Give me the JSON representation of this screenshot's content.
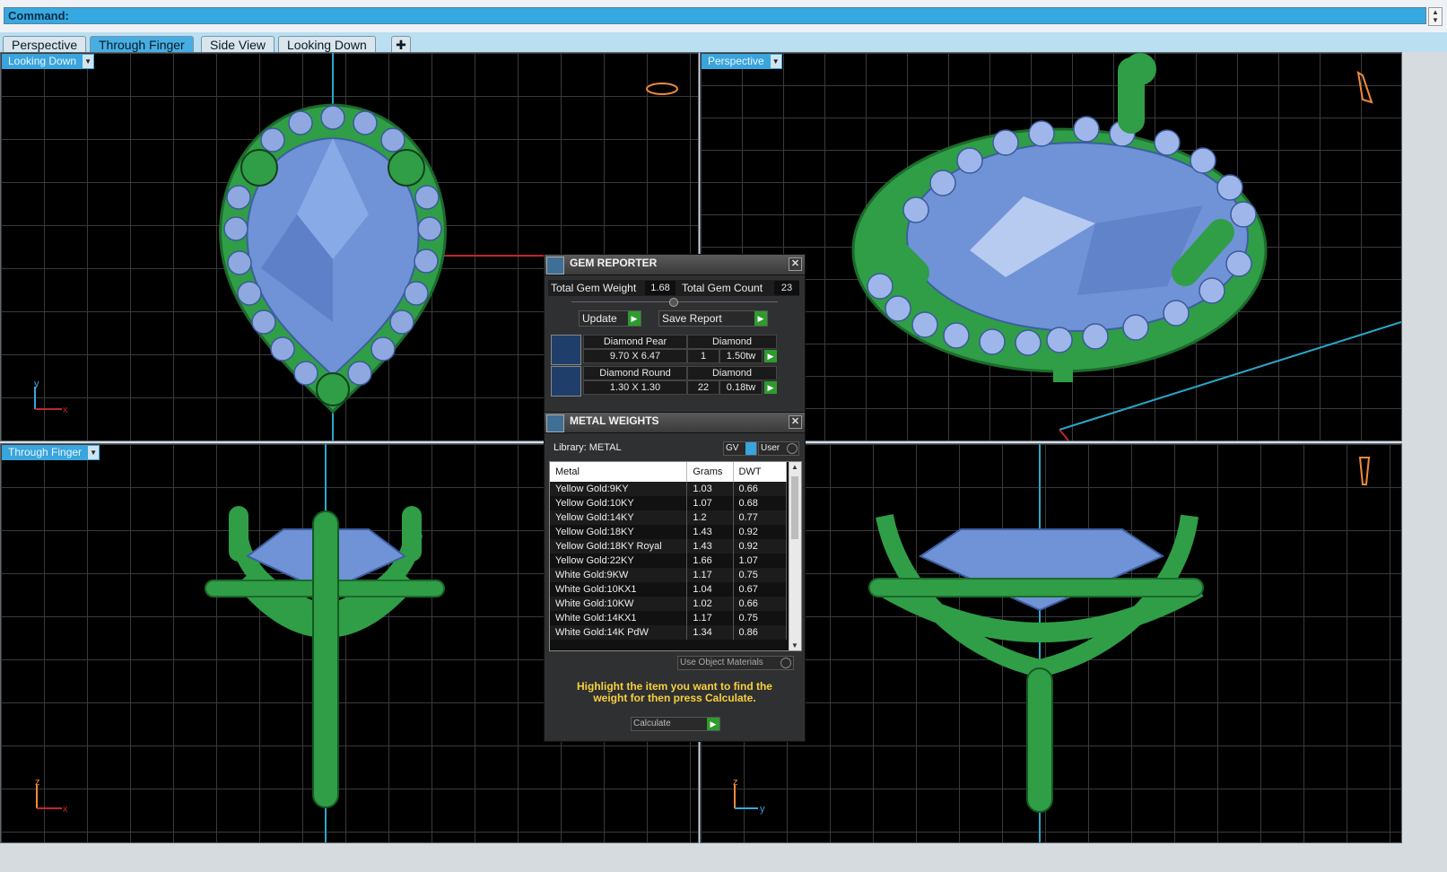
{
  "command_bar": {
    "label": "Command:"
  },
  "tabs": [
    {
      "label": "Perspective",
      "active": false
    },
    {
      "label": "Through Finger",
      "active": true
    },
    {
      "label": "Side View",
      "active": false
    },
    {
      "label": "Looking Down",
      "active": false
    }
  ],
  "tab_add_icon": "plus-icon",
  "viewports": {
    "top_left": {
      "label": "Looking Down",
      "axes": [
        "y",
        "x"
      ]
    },
    "top_right": {
      "label": "Perspective"
    },
    "bottom_left": {
      "label": "Through Finger",
      "axes": [
        "z",
        "x"
      ]
    },
    "bottom_right": {
      "axes": [
        "z",
        "y"
      ]
    }
  },
  "gem_reporter": {
    "title": "GEM REPORTER",
    "total_weight_label": "Total Gem Weight",
    "total_weight": "1.68",
    "total_count_label": "Total Gem Count",
    "total_count": "23",
    "update_label": "Update",
    "save_label": "Save Report",
    "gems": [
      {
        "name": "Diamond Pear",
        "material": "Diamond",
        "size": "9.70 X 6.47",
        "count": "1",
        "weight": "1.50tw"
      },
      {
        "name": "Diamond Round",
        "material": "Diamond",
        "size": "1.30 X 1.30",
        "count": "22",
        "weight": "0.18tw"
      }
    ]
  },
  "metal_weights": {
    "title": "METAL WEIGHTS",
    "library_label": "Library: METAL",
    "gv_label": "GV",
    "user_label": "User",
    "columns": [
      "Metal",
      "Grams",
      "DWT"
    ],
    "rows": [
      [
        "Yellow Gold:9KY",
        "1.03",
        "0.66"
      ],
      [
        "Yellow Gold:10KY",
        "1.07",
        "0.68"
      ],
      [
        "Yellow Gold:14KY",
        "1.2",
        "0.77"
      ],
      [
        "Yellow Gold:18KY",
        "1.43",
        "0.92"
      ],
      [
        "Yellow Gold:18KY Royal",
        "1.43",
        "0.92"
      ],
      [
        "Yellow Gold:22KY",
        "1.66",
        "1.07"
      ],
      [
        "White Gold:9KW",
        "1.17",
        "0.75"
      ],
      [
        "White Gold:10KX1",
        "1.04",
        "0.67"
      ],
      [
        "White Gold:10KW",
        "1.02",
        "0.66"
      ],
      [
        "White Gold:14KX1",
        "1.17",
        "0.75"
      ],
      [
        "White Gold:14K PdW",
        "1.34",
        "0.86"
      ]
    ],
    "use_object_materials_label": "Use Object Materials",
    "hint": "Highlight the item you want to find the weight for then press Calculate.",
    "calculate_label": "Calculate"
  },
  "colors": {
    "metal_green": "#2f9e46",
    "gem_blue": "#6f93d6",
    "accent_blue": "#3aa4dc",
    "hint_yellow": "#f7d13c"
  }
}
